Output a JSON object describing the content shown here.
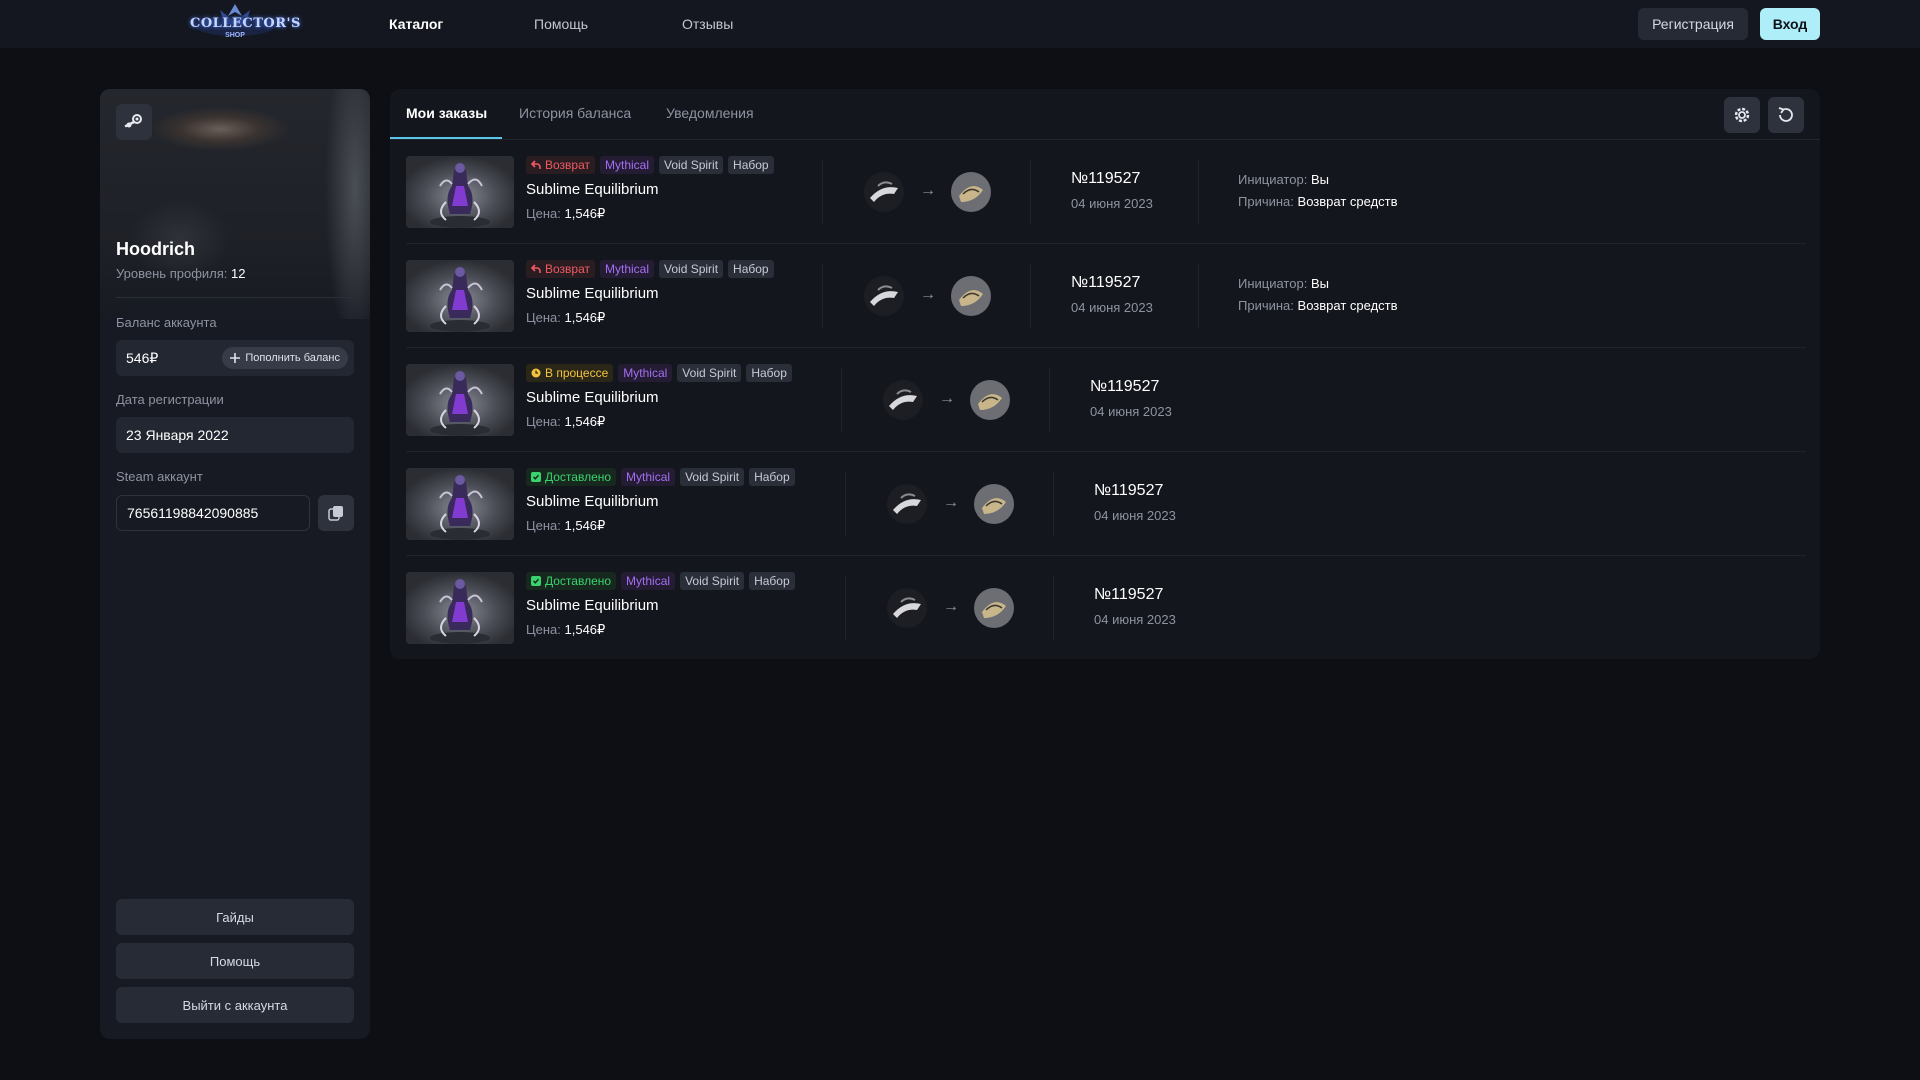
{
  "nav": {
    "logo_text": "COLLECTOR'S",
    "logo_sub": "SHOP",
    "links": [
      "Каталог",
      "Помощь",
      "Отзывы"
    ],
    "register_label": "Регистрация",
    "login_label": "Вход"
  },
  "profile": {
    "username": "Hoodrich",
    "level_label": "Уровень профиля:",
    "level_value": "12",
    "balance_label": "Баланс аккаунта",
    "balance_value": "546₽",
    "topup_label": "Пополнить баланс",
    "reg_date_label": "Дата регистрации",
    "reg_date_value": "23 Января 2022",
    "steam_label": "Steam аккаунт",
    "steam_value": "76561198842090885",
    "buttons": [
      "Гайды",
      "Помощь",
      "Выйти с аккаунта"
    ]
  },
  "tabs": [
    "Мои заказы",
    "История баланса",
    "Уведомления"
  ],
  "icons": {
    "steam": "steam-icon",
    "settings": "gear-icon",
    "refresh": "refresh-icon",
    "copy": "copy-icon",
    "plus": "plus-icon",
    "arrow": "arrow-right-icon"
  },
  "colors": {
    "accent": "#aeeef9",
    "tab_underline": "#5bc7e8",
    "return": "#ee5a63",
    "progress": "#f3c340",
    "delivered": "#38d36f",
    "mythical": "#a56ef4"
  },
  "orders": [
    {
      "status": "Возврат",
      "rarity": "Mythical",
      "hero": "Void Spirit",
      "type": "Набор",
      "name": "Sublime Equilibrium",
      "price_label": "Цена:",
      "price": "1,546₽",
      "arrow": "→",
      "number": "№119527",
      "date": "04 июня 2023",
      "initiator_label": "Инициатор:",
      "initiator": "Вы",
      "reason_label": "Причина:",
      "reason": "Возврат средств"
    },
    {
      "status": "Возврат",
      "rarity": "Mythical",
      "hero": "Void Spirit",
      "type": "Набор",
      "name": "Sublime Equilibrium",
      "price_label": "Цена:",
      "price": "1,546₽",
      "arrow": "→",
      "number": "№119527",
      "date": "04 июня 2023",
      "initiator_label": "Инициатор:",
      "initiator": "Вы",
      "reason_label": "Причина:",
      "reason": "Возврат средств"
    },
    {
      "status": "В процессе",
      "rarity": "Mythical",
      "hero": "Void Spirit",
      "type": "Набор",
      "name": "Sublime Equilibrium",
      "price_label": "Цена:",
      "price": "1,546₽",
      "arrow": "→",
      "number": "№119527",
      "date": "04 июня 2023"
    },
    {
      "status": "Доставлено",
      "rarity": "Mythical",
      "hero": "Void Spirit",
      "type": "Набор",
      "name": "Sublime Equilibrium",
      "price_label": "Цена:",
      "price": "1,546₽",
      "arrow": "→",
      "number": "№119527",
      "date": "04 июня 2023"
    },
    {
      "status": "Доставлено",
      "rarity": "Mythical",
      "hero": "Void Spirit",
      "type": "Набор",
      "name": "Sublime Equilibrium",
      "price_label": "Цена:",
      "price": "1,546₽",
      "arrow": "→",
      "number": "№119527",
      "date": "04 июня 2023"
    }
  ]
}
